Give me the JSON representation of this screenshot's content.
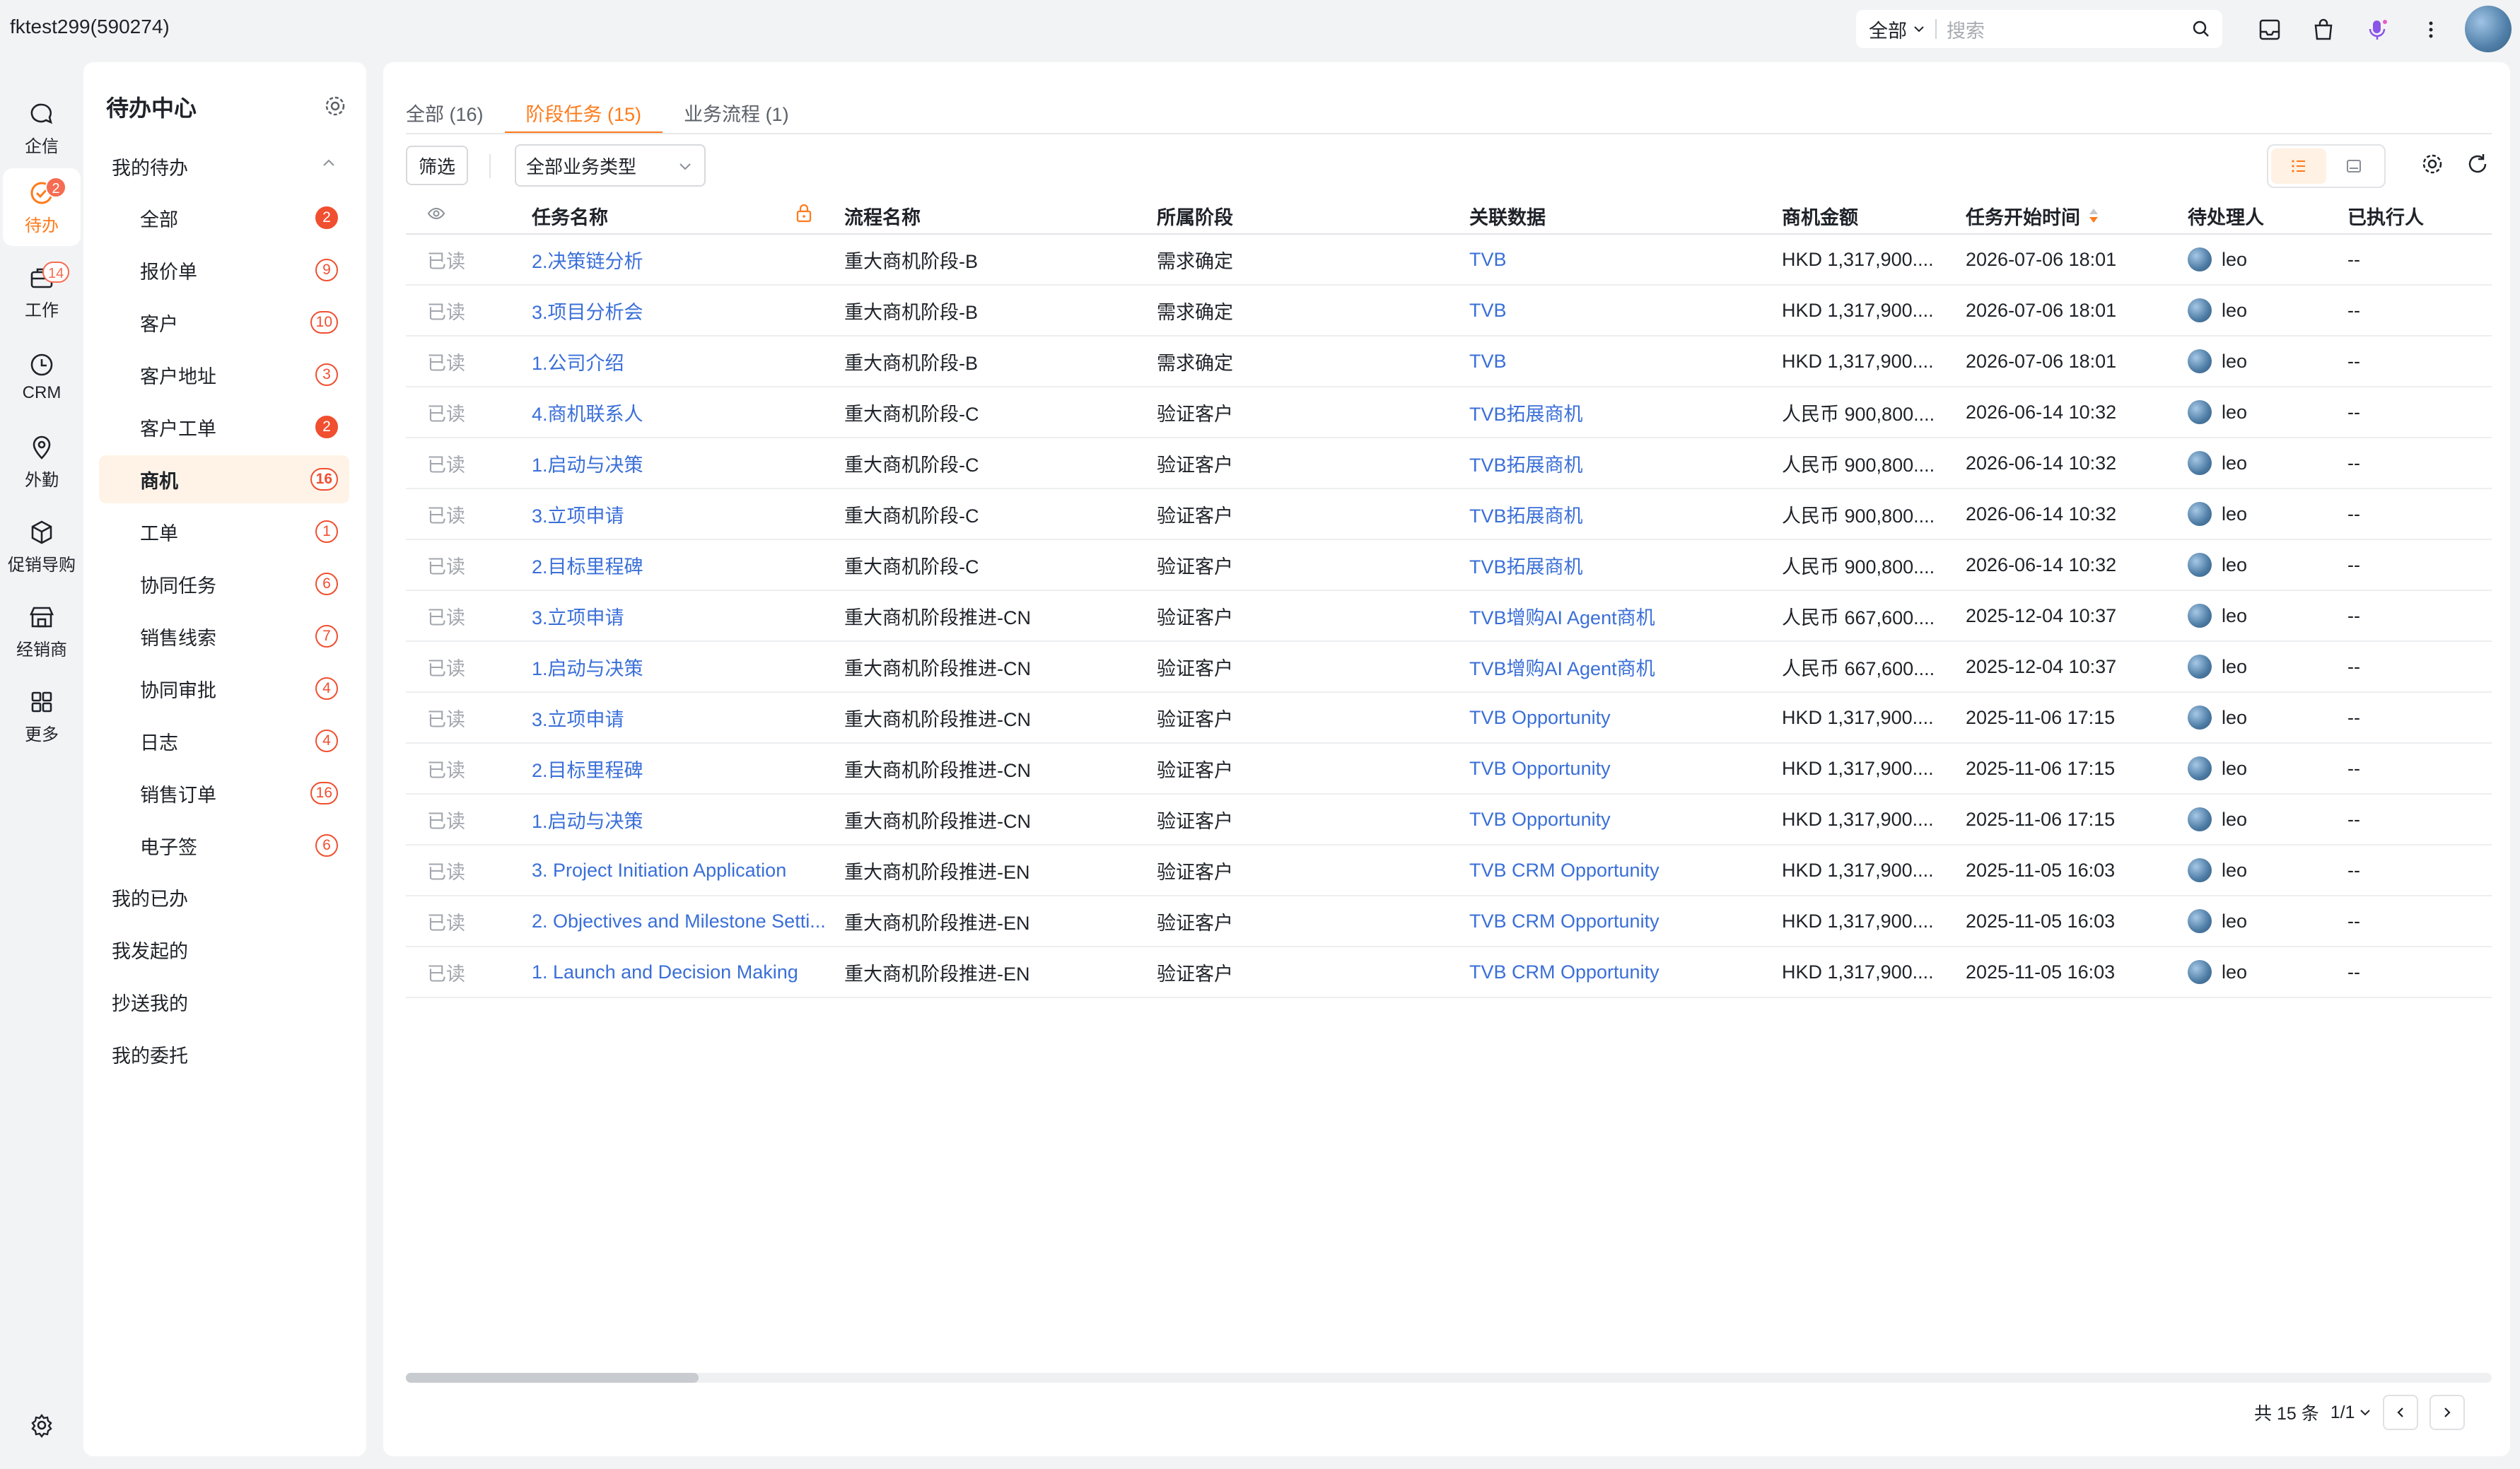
{
  "topbar": {
    "account": "fktest299(590274)",
    "search_scope": "全部",
    "search_placeholder": "搜索"
  },
  "rail": {
    "items": [
      {
        "label": "企信",
        "icon": "chat-icon",
        "badge": ""
      },
      {
        "label": "待办",
        "icon": "check-circle-icon",
        "badge": "2"
      },
      {
        "label": "工作",
        "icon": "briefcase-icon",
        "badge": "14"
      },
      {
        "label": "CRM",
        "icon": "clock-icon",
        "badge": ""
      },
      {
        "label": "外勤",
        "icon": "location-pin-icon",
        "badge": ""
      },
      {
        "label": "促销导购",
        "icon": "box-icon",
        "badge": ""
      },
      {
        "label": "经销商",
        "icon": "store-icon",
        "badge": ""
      },
      {
        "label": "更多",
        "icon": "grid-icon",
        "badge": ""
      }
    ]
  },
  "sidebar": {
    "title": "待办中心",
    "group_label": "我的待办",
    "items": [
      {
        "label": "全部",
        "badge": "2",
        "style": "solid"
      },
      {
        "label": "报价单",
        "badge": "9",
        "style": "outline"
      },
      {
        "label": "客户",
        "badge": "10",
        "style": "outline"
      },
      {
        "label": "客户地址",
        "badge": "3",
        "style": "outline"
      },
      {
        "label": "客户工单",
        "badge": "2",
        "style": "solid"
      },
      {
        "label": "商机",
        "badge": "16",
        "style": "outline"
      },
      {
        "label": "工单",
        "badge": "1",
        "style": "outline"
      },
      {
        "label": "协同任务",
        "badge": "6",
        "style": "outline"
      },
      {
        "label": "销售线索",
        "badge": "7",
        "style": "outline"
      },
      {
        "label": "协同审批",
        "badge": "4",
        "style": "outline"
      },
      {
        "label": "日志",
        "badge": "4",
        "style": "outline"
      },
      {
        "label": "销售订单",
        "badge": "16",
        "style": "outline"
      },
      {
        "label": "电子签",
        "badge": "6",
        "style": "outline"
      }
    ],
    "other_groups": [
      "我的已办",
      "我发起的",
      "抄送我的",
      "我的委托"
    ]
  },
  "tabs": [
    {
      "label": "全部 (16)"
    },
    {
      "label": "阶段任务 (15)"
    },
    {
      "label": "业务流程 (1)"
    }
  ],
  "toolbar": {
    "filter_label": "筛选",
    "type_select": "全部业务类型"
  },
  "table": {
    "columns": [
      "任务名称",
      "流程名称",
      "所属阶段",
      "关联数据",
      "商机金额",
      "任务开始时间",
      "待处理人",
      "已执行人"
    ],
    "rows": [
      {
        "read": "已读",
        "task": "2.决策链分析",
        "process": "重大商机阶段-B",
        "stage": "需求确定",
        "related": "TVB",
        "amount": "HKD 1,317,900....",
        "start": "2026-07-06 18:01",
        "assignee": "leo",
        "executed": "--"
      },
      {
        "read": "已读",
        "task": "3.项目分析会",
        "process": "重大商机阶段-B",
        "stage": "需求确定",
        "related": "TVB",
        "amount": "HKD 1,317,900....",
        "start": "2026-07-06 18:01",
        "assignee": "leo",
        "executed": "--"
      },
      {
        "read": "已读",
        "task": "1.公司介绍",
        "process": "重大商机阶段-B",
        "stage": "需求确定",
        "related": "TVB",
        "amount": "HKD 1,317,900....",
        "start": "2026-07-06 18:01",
        "assignee": "leo",
        "executed": "--"
      },
      {
        "read": "已读",
        "task": "4.商机联系人",
        "process": "重大商机阶段-C",
        "stage": "验证客户",
        "related": "TVB拓展商机",
        "amount": "人民币 900,800....",
        "start": "2026-06-14 10:32",
        "assignee": "leo",
        "executed": "--"
      },
      {
        "read": "已读",
        "task": "1.启动与决策",
        "process": "重大商机阶段-C",
        "stage": "验证客户",
        "related": "TVB拓展商机",
        "amount": "人民币 900,800....",
        "start": "2026-06-14 10:32",
        "assignee": "leo",
        "executed": "--"
      },
      {
        "read": "已读",
        "task": "3.立项申请",
        "process": "重大商机阶段-C",
        "stage": "验证客户",
        "related": "TVB拓展商机",
        "amount": "人民币 900,800....",
        "start": "2026-06-14 10:32",
        "assignee": "leo",
        "executed": "--"
      },
      {
        "read": "已读",
        "task": "2.目标里程碑",
        "process": "重大商机阶段-C",
        "stage": "验证客户",
        "related": "TVB拓展商机",
        "amount": "人民币 900,800....",
        "start": "2026-06-14 10:32",
        "assignee": "leo",
        "executed": "--"
      },
      {
        "read": "已读",
        "task": "3.立项申请",
        "process": "重大商机阶段推进-CN",
        "stage": "验证客户",
        "related": "TVB增购AI Agent商机",
        "amount": "人民币 667,600....",
        "start": "2025-12-04 10:37",
        "assignee": "leo",
        "executed": "--"
      },
      {
        "read": "已读",
        "task": "1.启动与决策",
        "process": "重大商机阶段推进-CN",
        "stage": "验证客户",
        "related": "TVB增购AI Agent商机",
        "amount": "人民币 667,600....",
        "start": "2025-12-04 10:37",
        "assignee": "leo",
        "executed": "--"
      },
      {
        "read": "已读",
        "task": "3.立项申请",
        "process": "重大商机阶段推进-CN",
        "stage": "验证客户",
        "related": "TVB Opportunity",
        "amount": "HKD 1,317,900....",
        "start": "2025-11-06 17:15",
        "assignee": "leo",
        "executed": "--"
      },
      {
        "read": "已读",
        "task": "2.目标里程碑",
        "process": "重大商机阶段推进-CN",
        "stage": "验证客户",
        "related": "TVB Opportunity",
        "amount": "HKD 1,317,900....",
        "start": "2025-11-06 17:15",
        "assignee": "leo",
        "executed": "--"
      },
      {
        "read": "已读",
        "task": "1.启动与决策",
        "process": "重大商机阶段推进-CN",
        "stage": "验证客户",
        "related": "TVB Opportunity",
        "amount": "HKD 1,317,900....",
        "start": "2025-11-06 17:15",
        "assignee": "leo",
        "executed": "--"
      },
      {
        "read": "已读",
        "task": "3. Project Initiation Application",
        "process": "重大商机阶段推进-EN",
        "stage": "验证客户",
        "related": "TVB CRM Opportunity",
        "amount": "HKD 1,317,900....",
        "start": "2025-11-05 16:03",
        "assignee": "leo",
        "executed": "--"
      },
      {
        "read": "已读",
        "task": "2. Objectives and Milestone Setti...",
        "process": "重大商机阶段推进-EN",
        "stage": "验证客户",
        "related": "TVB CRM Opportunity",
        "amount": "HKD 1,317,900....",
        "start": "2025-11-05 16:03",
        "assignee": "leo",
        "executed": "--"
      },
      {
        "read": "已读",
        "task": "1. Launch and Decision Making",
        "process": "重大商机阶段推进-EN",
        "stage": "验证客户",
        "related": "TVB CRM Opportunity",
        "amount": "HKD 1,317,900....",
        "start": "2025-11-05 16:03",
        "assignee": "leo",
        "executed": "--"
      }
    ]
  },
  "pager": {
    "total": "共 15 条",
    "page": "1/1"
  },
  "colors": {
    "accent": "#ff7a1a",
    "link": "#3a6fd8",
    "badge": "#f04f30"
  }
}
